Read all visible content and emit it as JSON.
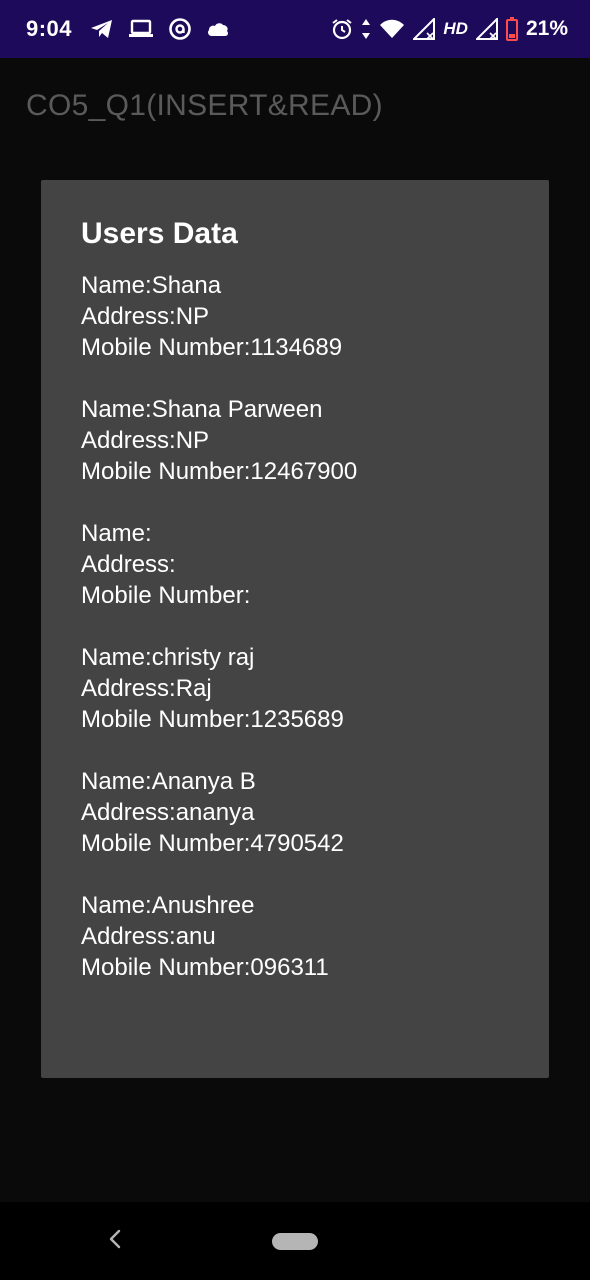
{
  "status_bar": {
    "time": "9:04",
    "left_icons": [
      "telegram-icon",
      "laptop-icon",
      "at-sign-icon",
      "cloud-icon"
    ],
    "right_icons": [
      "alarm-icon",
      "data-arrows-icon",
      "wifi-icon",
      "signal-icon",
      "signal-icon",
      "battery-icon"
    ],
    "network_label": "HD",
    "battery": "21%",
    "background": "#1e0a5a"
  },
  "app_bar": {
    "title": "CO5_Q1(INSERT&READ)"
  },
  "card": {
    "title": "Users Data",
    "background": "#444444",
    "records": [
      {
        "name": "Name:Shana",
        "address": "Address:NP",
        "mobile": "Mobile Number:1134689"
      },
      {
        "name": "Name:Shana Parween",
        "address": "Address:NP",
        "mobile": "Mobile Number:12467900"
      },
      {
        "name": "Name:",
        "address": "Address:",
        "mobile": "Mobile Number:"
      },
      {
        "name": "Name:christy raj",
        "address": "Address:Raj",
        "mobile": "Mobile Number:1235689"
      },
      {
        "name": "Name:Ananya B",
        "address": "Address:ananya",
        "mobile": "Mobile Number:4790542"
      },
      {
        "name": "Name:Anushree",
        "address": "Address:anu",
        "mobile": "Mobile Number:096311"
      }
    ]
  },
  "nav_bar": {
    "back_icon": "chevron-left-icon",
    "home_icon": "home-pill-icon"
  }
}
